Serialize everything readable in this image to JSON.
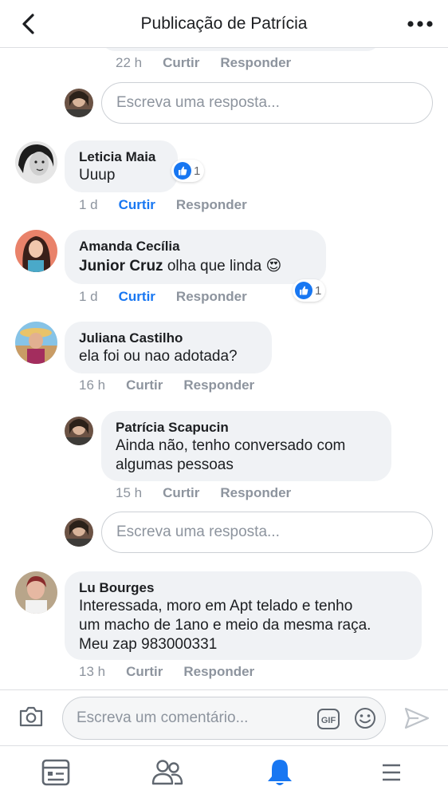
{
  "header": {
    "title": "Publicação de Patrícia"
  },
  "actions": {
    "like": "Curtir",
    "reply": "Responder"
  },
  "top_partial": {
    "time": "22 h"
  },
  "reply_input_placeholder": "Escreva uma resposta...",
  "comments": [
    {
      "name": "Leticia Maia",
      "text": "Uuup",
      "time": "1 d",
      "liked": true,
      "reaction_count": "1"
    },
    {
      "name": "Amanda Cecília",
      "mention": "Junior Cruz",
      "text": " olha que linda",
      "emoji": "😍",
      "time": "1 d",
      "liked": true,
      "reaction_count": "1"
    },
    {
      "name": "Juliana Castilho",
      "text": "ela foi ou nao adotada?",
      "time": "16 h",
      "liked": false
    },
    {
      "name": "Lu Bourges",
      "lines": [
        "Interessada, moro em Apt telado e tenho",
        "um macho de 1ano e meio da mesma raça.",
        "Meu zap 983000331"
      ],
      "time": "13 h",
      "liked": false
    }
  ],
  "reply": {
    "name": "Patrícia Scapucin",
    "lines": [
      "Ainda não, tenho conversado com",
      "algumas pessoas"
    ],
    "time": "15 h"
  },
  "composer": {
    "placeholder": "Escreva um comentário...",
    "gif_label": "GIF"
  },
  "colors": {
    "accent": "#1877f2",
    "bubble": "#f0f2f5",
    "muted": "#8d949e"
  }
}
